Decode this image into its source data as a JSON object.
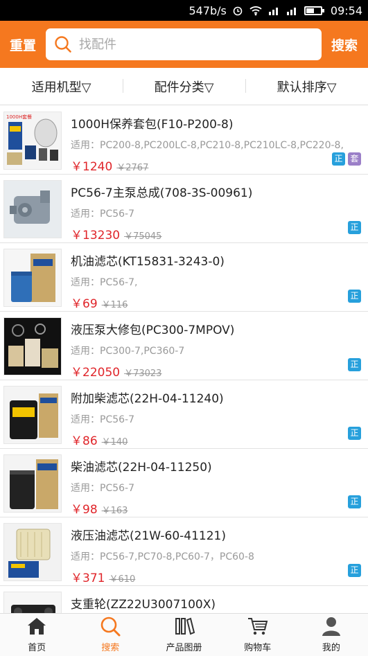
{
  "status_bar": {
    "speed": "547b/s",
    "time": "09:54"
  },
  "header": {
    "reset_label": "重置",
    "search_placeholder": "找配件",
    "search_label": "搜索"
  },
  "filters": [
    "适用机型▽",
    "配件分类▽",
    "默认排序▽"
  ],
  "colors": {
    "brand": "#f5781f",
    "price": "#e0252a",
    "badge_genuine": "#27a0dc",
    "badge_kit": "#9b7fc8"
  },
  "products": [
    {
      "title": "1000H保养套包(F10-P200-8)",
      "fit": "适用：PC200-8,PC200LC-8,PC210-8,PC210LC-8,PC220-8,",
      "price": "￥1240",
      "old_price": "￥2767",
      "badges": [
        "正",
        "套"
      ],
      "thumb_label": "1000H套餐"
    },
    {
      "title": "PC56-7主泵总成(708-3S-00961)",
      "fit": "适用：PC56-7",
      "price": "￥13230",
      "old_price": "￥75045",
      "badges": [
        "正"
      ]
    },
    {
      "title": "机油滤芯(KT15831-3243-0)",
      "fit": "适用：PC56-7,",
      "price": "￥69",
      "old_price": "￥116",
      "badges": [
        "正"
      ]
    },
    {
      "title": "液压泵大修包(PC300-7MPOV)",
      "fit": "适用：PC300-7,PC360-7",
      "price": "￥22050",
      "old_price": "￥73023",
      "badges": [
        "正"
      ]
    },
    {
      "title": "附加柴滤芯(22H-04-11240)",
      "fit": "适用：PC56-7",
      "price": "￥86",
      "old_price": "￥140",
      "badges": [
        "正"
      ]
    },
    {
      "title": "柴油滤芯(22H-04-11250)",
      "fit": "适用：PC56-7",
      "price": "￥98",
      "old_price": "￥163",
      "badges": [
        "正"
      ]
    },
    {
      "title": "液压油滤芯(21W-60-41121)",
      "fit": "适用：PC56-7,PC70-8,PC60-7，PC60-8",
      "price": "￥371",
      "old_price": "￥610",
      "badges": [
        "正"
      ]
    },
    {
      "title": "支重轮(ZZ22U3007100X)",
      "fit": "",
      "price": "",
      "old_price": "",
      "badges": []
    }
  ],
  "bottom_nav": [
    {
      "label": "首页",
      "icon": "home-icon"
    },
    {
      "label": "搜索",
      "icon": "search-icon",
      "active": true
    },
    {
      "label": "产品图册",
      "icon": "catalog-icon"
    },
    {
      "label": "购物车",
      "icon": "cart-icon"
    },
    {
      "label": "我的",
      "icon": "user-icon"
    }
  ]
}
